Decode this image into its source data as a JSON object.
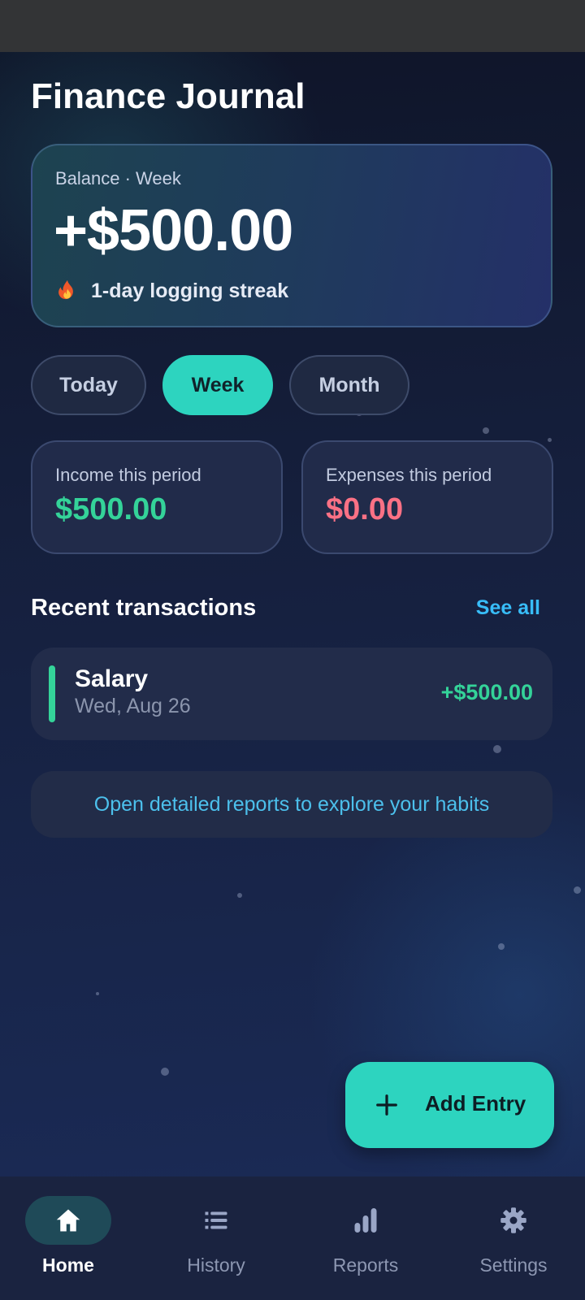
{
  "app": {
    "title": "Finance Journal"
  },
  "balance": {
    "label": "Balance · Week",
    "value": "+$500.00",
    "streak_text": "1-day logging streak",
    "streak_icon": "fire-icon"
  },
  "period_tabs": [
    {
      "label": "Today",
      "active": false
    },
    {
      "label": "Week",
      "active": true
    },
    {
      "label": "Month",
      "active": false
    }
  ],
  "stats": {
    "income": {
      "label": "Income this period",
      "value": "$500.00",
      "color": "#34d399"
    },
    "expenses": {
      "label": "Expenses this period",
      "value": "$0.00",
      "color": "#fb7185"
    }
  },
  "recent": {
    "title": "Recent transactions",
    "see_all": "See all",
    "items": [
      {
        "title": "Salary",
        "date": "Wed, Aug 26",
        "amount": "+$500.00",
        "type": "income"
      }
    ]
  },
  "reports_link": "Open detailed reports to explore your habits",
  "fab": {
    "label": "Add Entry",
    "icon": "plus-icon"
  },
  "nav": [
    {
      "label": "Home",
      "icon": "home-icon",
      "active": true
    },
    {
      "label": "History",
      "icon": "list-icon",
      "active": false
    },
    {
      "label": "Reports",
      "icon": "bar-chart-icon",
      "active": false
    },
    {
      "label": "Settings",
      "icon": "gear-icon",
      "active": false
    }
  ],
  "colors": {
    "accent": "#2dd4bf",
    "income": "#34d399",
    "expense": "#fb7185",
    "link": "#38bdf8"
  }
}
